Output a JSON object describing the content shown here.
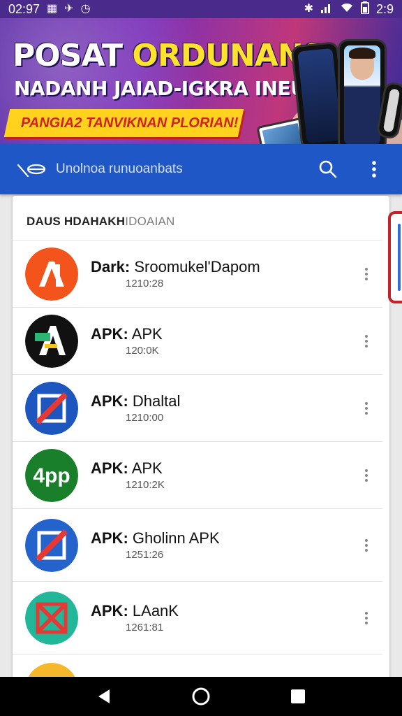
{
  "status_bar": {
    "time": "02:97",
    "left_icons": [
      "grid-icon",
      "airplane-icon",
      "alarm-icon"
    ],
    "right_icons": [
      "bluetooth-icon",
      "signal-icon",
      "wifi-icon",
      "battery-icon"
    ],
    "right_time": "2:9"
  },
  "banner": {
    "title_part1": "POSAT",
    "title_part2": "ORDUNANSIA",
    "subtitle": "NADANH JAIAD-IGKRA INEUBZA",
    "ribbon": "PANGIA2 TANVIKNAN PLORIAN!"
  },
  "toolbar": {
    "search_hint": "Unolnoa runuoanbats",
    "accent": "#1f57c7"
  },
  "list": {
    "section_title": "DAUS HDAHAKH",
    "section_title_muted": "IDOAIAN",
    "apps": [
      {
        "prefix": "Dark:",
        "name": "Sroomukel'Dapom",
        "size": "1210:28",
        "icon": "orange-a-icon",
        "color": "#f2541b"
      },
      {
        "prefix": "APK:",
        "name": "APK",
        "size": "120:0K",
        "icon": "black-a-icon",
        "color": "#111111"
      },
      {
        "prefix": "APK:",
        "name": "Dhaltal",
        "size": "1210:00",
        "icon": "blue-slash-icon",
        "color": "#1e56c0"
      },
      {
        "prefix": "APK:",
        "name": "APK",
        "size": "1210:2K",
        "icon": "green-4pp-icon",
        "color": "#1a7f2a"
      },
      {
        "prefix": "APK:",
        "name": "Gholinn APK",
        "size": "1251:26",
        "icon": "blue-slash-icon",
        "color": "#2463cc"
      },
      {
        "prefix": "APK:",
        "name": "LAanK",
        "size": "1261:81",
        "icon": "teal-x-icon",
        "color": "#23b79a"
      },
      {
        "prefix": "",
        "name": "",
        "size": "",
        "icon": "yellow-circle-icon",
        "color": "#f5b82a"
      }
    ]
  },
  "nav_bar": {
    "buttons": [
      "back-icon",
      "home-icon",
      "recents-icon"
    ]
  }
}
